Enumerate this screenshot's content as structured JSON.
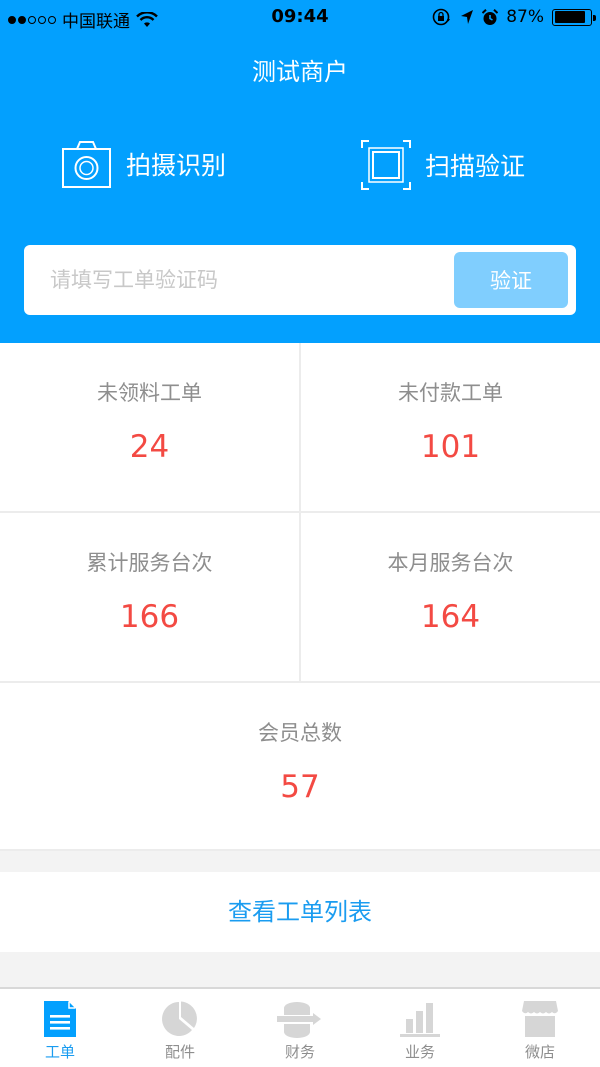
{
  "status_bar": {
    "carrier": "中国联通",
    "signal_strength": 2,
    "signal_max": 5,
    "time": "09:44",
    "battery_percent": "87%",
    "battery_level": 0.87,
    "icons": [
      "wifi-icon",
      "orientation-lock-icon",
      "location-arrow-icon",
      "alarm-icon",
      "battery-icon"
    ]
  },
  "header": {
    "title": "测试商户",
    "actions": [
      {
        "label": "拍摄识别",
        "icon": "camera-icon"
      },
      {
        "label": "扫描验证",
        "icon": "scan-frame-icon"
      }
    ]
  },
  "verify": {
    "placeholder": "请填写工单验证码",
    "value": "",
    "button_label": "验证"
  },
  "stats": [
    {
      "label": "未领料工单",
      "value": "24"
    },
    {
      "label": "未付款工单",
      "value": "101"
    },
    {
      "label": "累计服务台次",
      "value": "166"
    },
    {
      "label": "本月服务台次",
      "value": "164"
    },
    {
      "label": "会员总数",
      "value": "57"
    }
  ],
  "list_link": {
    "label": "查看工单列表"
  },
  "tabbar": {
    "active_index": 0,
    "tabs": [
      {
        "label": "工单",
        "icon": "document-icon"
      },
      {
        "label": "配件",
        "icon": "pie-chart-icon"
      },
      {
        "label": "财务",
        "icon": "database-transfer-icon"
      },
      {
        "label": "业务",
        "icon": "bar-chart-icon"
      },
      {
        "label": "微店",
        "icon": "storefront-icon"
      }
    ]
  },
  "colors": {
    "brand_blue": "#03a0fe",
    "button_light_blue": "#80cefe",
    "stat_value_red": "#f34a43",
    "link_blue": "#1a9cf0",
    "inactive_gray": "#d6d6d6"
  }
}
